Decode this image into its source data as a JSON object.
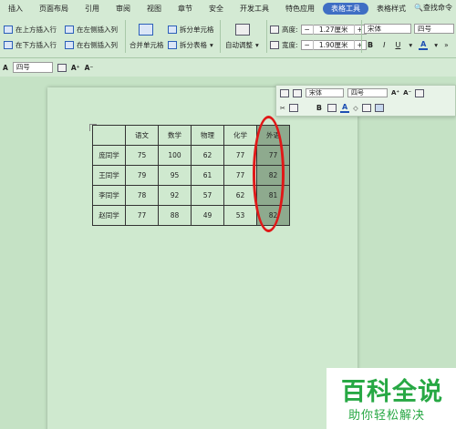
{
  "menu": {
    "items": [
      "插入",
      "页面布局",
      "引用",
      "审阅",
      "视图",
      "章节",
      "安全",
      "开发工具",
      "特色应用",
      "表格工具",
      "表格样式"
    ],
    "active": "表格工具",
    "search": "查找命令"
  },
  "ribbon": {
    "insert_above": "在上方插入行",
    "insert_below": "在下方插入行",
    "insert_left": "在左侧插入列",
    "insert_right": "在右侧插入列",
    "merge": "合并单元格",
    "split_cells": "拆分单元格",
    "split_table": "拆分表格",
    "autofit": "自动调整",
    "height_label": "高度:",
    "height_value": "1.27厘米",
    "width_label": "宽度:",
    "width_value": "1.90厘米",
    "font": "宋体",
    "size": "四号",
    "minus": "−",
    "plus": "+"
  },
  "toolbar2": {
    "size": "四号"
  },
  "mini_toolbar": {
    "font": "宋体",
    "size": "四号"
  },
  "table": {
    "header": [
      "",
      "语文",
      "数学",
      "物理",
      "化学",
      "外语"
    ],
    "rows": [
      [
        "庞同学",
        "75",
        "100",
        "62",
        "77",
        "77"
      ],
      [
        "王同学",
        "79",
        "95",
        "61",
        "77",
        "82"
      ],
      [
        "李同学",
        "78",
        "92",
        "57",
        "62",
        "81"
      ],
      [
        "赵同学",
        "77",
        "88",
        "49",
        "53",
        "82"
      ]
    ]
  },
  "watermark": {
    "title": "百科全说",
    "subtitle": "助你轻松解决"
  }
}
